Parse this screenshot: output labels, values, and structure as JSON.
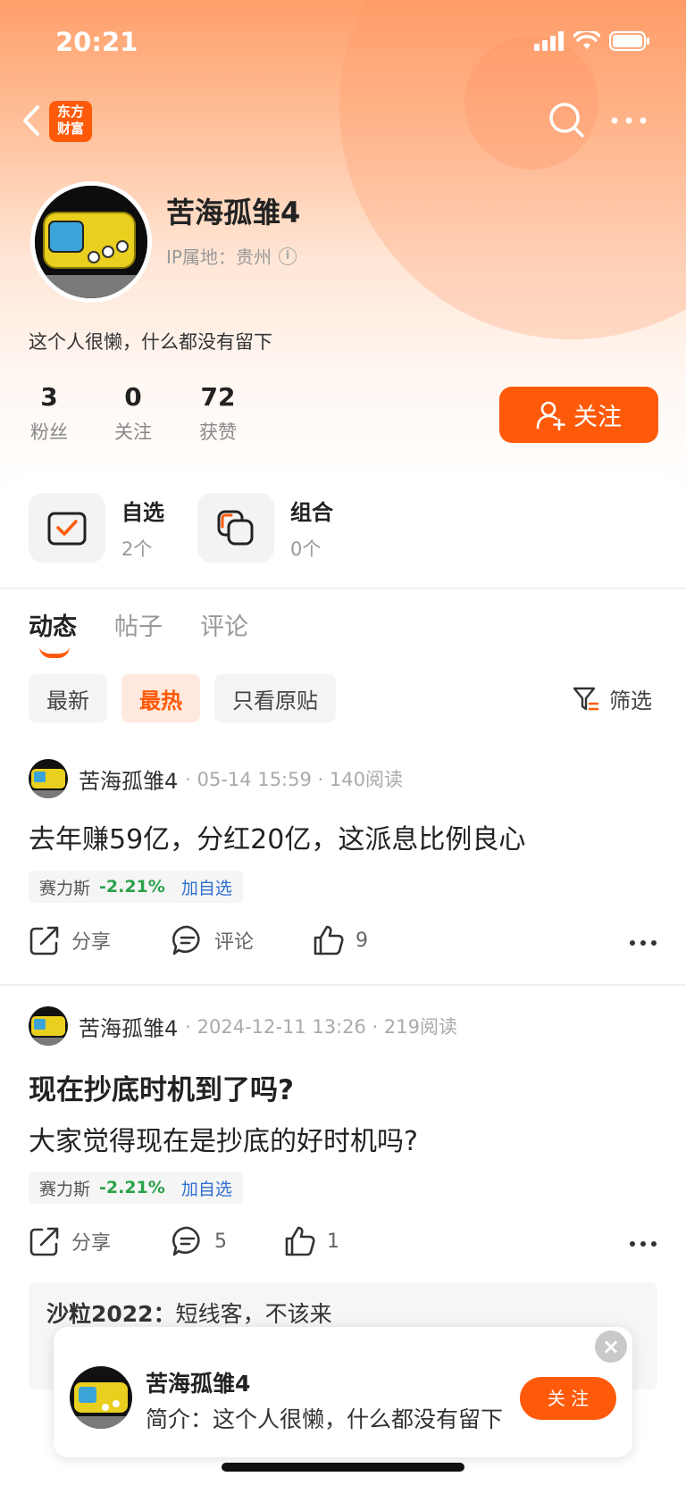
{
  "status_bar": {
    "time": "20:21"
  },
  "nav": {
    "brand_logo_line1": "东方",
    "brand_logo_line2": "财富"
  },
  "profile": {
    "name": "苦海孤雏4",
    "ip_label": "IP属地：贵州",
    "bio": "这个人很懒，什么都没有留下",
    "stats": [
      {
        "value": "3",
        "label": "粉丝"
      },
      {
        "value": "0",
        "label": "关注"
      },
      {
        "value": "72",
        "label": "获赞"
      }
    ],
    "follow_label": "关注"
  },
  "quick": [
    {
      "title": "自选",
      "sub": "2个"
    },
    {
      "title": "组合",
      "sub": "0个"
    }
  ],
  "tabs": [
    "动态",
    "帖子",
    "评论"
  ],
  "filters": [
    "最新",
    "最热",
    "只看原贴"
  ],
  "filter_button": "筛选",
  "posts": [
    {
      "author": "苦海孤雏4",
      "meta": "· 05-14 15:59 · 140阅读",
      "body": "去年赚59亿，分红20亿，这派息比例良心",
      "stock": {
        "name": "赛力斯",
        "change": "-2.21%",
        "add": "加自选"
      },
      "share": "分享",
      "comment": "评论",
      "likes": "9"
    },
    {
      "author": "苦海孤雏4",
      "meta": "· 2024-12-11 13:26 · 219阅读",
      "title": "现在抄底时机到了吗?",
      "body": "大家觉得现在是抄底的好时机吗?",
      "stock": {
        "name": "赛力斯",
        "change": "-2.21%",
        "add": "加自选"
      },
      "share": "分享",
      "comment": "5",
      "likes": "1"
    }
  ],
  "comment": {
    "user": "沙粒2022：",
    "text": "短线客，不该来"
  },
  "popup": {
    "name": "苦海孤雏4",
    "bio": "简介：这个人很懒，什么都没有留下",
    "follow": "关 注"
  },
  "colors": {
    "accent": "#ff5a0a",
    "stock_down": "#2aa24a",
    "link": "#2f6fd1"
  }
}
